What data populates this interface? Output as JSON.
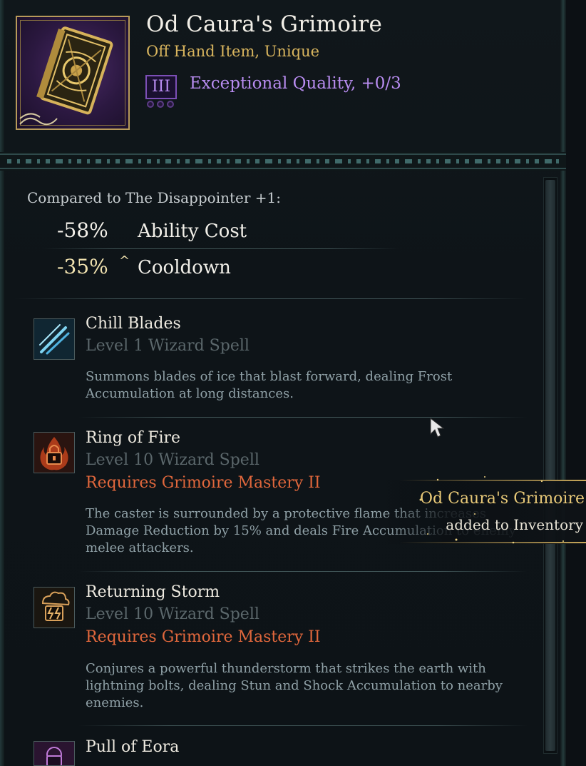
{
  "item": {
    "name": "Od Caura's Grimoire",
    "type": "Off Hand Item, Unique",
    "tier": "III",
    "quality": "Exceptional Quality, +0/3"
  },
  "compare": {
    "label": "Compared to The Disappointer +1:",
    "stats": [
      {
        "value": "-58%",
        "name": "Ability Cost",
        "arrow": "",
        "color": "#f4f1ea"
      },
      {
        "value": "-35%",
        "name": "Cooldown",
        "arrow": "^",
        "color": "#f2e3b0"
      }
    ]
  },
  "spells": [
    {
      "name": "Chill Blades",
      "level": "Level 1 Wizard Spell",
      "requirement": "",
      "desc1": "Summons blades of ice that blast forward, dealing Frost",
      "desc2": "Accumulation at long distances.",
      "desc3": "",
      "icon": "ice-blades-icon"
    },
    {
      "name": "Ring of Fire",
      "level": "Level 10 Wizard Spell",
      "requirement": "Requires Grimoire Mastery II",
      "desc1": "The caster is surrounded by a protective flame that increases",
      "desc2": "Damage Reduction by 15% and deals Fire Accumulation to enemy",
      "desc3": "melee attackers.",
      "icon": "locked-fire-icon"
    },
    {
      "name": "Returning Storm",
      "level": "Level 10 Wizard Spell",
      "requirement": "Requires Grimoire Mastery II",
      "desc1": "Conjures a powerful thunderstorm that strikes the earth with",
      "desc2": "lightning bolts, dealing Stun and Shock Accumulation to nearby",
      "desc3": "enemies.",
      "icon": "locked-storm-icon"
    },
    {
      "name": "Pull of Eora",
      "icon": "locked-eora-icon"
    }
  ],
  "toast": {
    "title": "Od Caura's Grimoire",
    "subtitle": "added to Inventory"
  }
}
